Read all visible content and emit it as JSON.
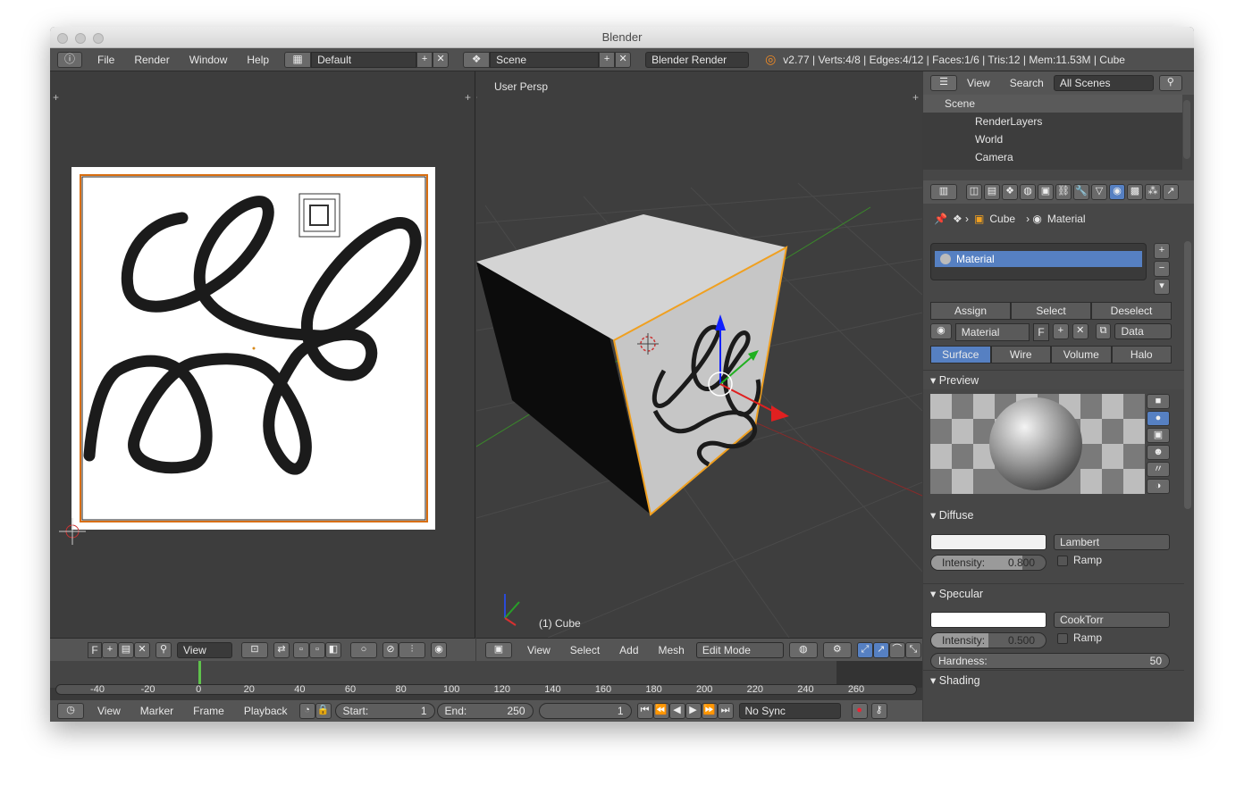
{
  "window": {
    "title": "Blender"
  },
  "topbar": {
    "menus": [
      "File",
      "Render",
      "Window",
      "Help"
    ],
    "layout_value": "Default",
    "scene_value": "Scene",
    "engine_value": "Blender Render",
    "stats": "v2.77 | Verts:4/8 | Edges:4/12 | Faces:1/6 | Tris:12 | Mem:11.53M | Cube"
  },
  "image_editor": {
    "header": {
      "f_label": "F",
      "view_label": "View"
    }
  },
  "viewport": {
    "view_label": "User Persp",
    "object_label": "(1) Cube",
    "header": {
      "view": "View",
      "select": "Select",
      "add": "Add",
      "mesh": "Mesh",
      "mode": "Edit Mode"
    }
  },
  "outliner": {
    "view": "View",
    "search": "Search",
    "filter": "All Scenes",
    "items": [
      "Scene",
      "RenderLayers",
      "World",
      "Camera"
    ]
  },
  "properties": {
    "breadcrumb": {
      "object": "Cube",
      "material": "Material"
    },
    "slot_name": "Material",
    "actions": [
      "Assign",
      "Select",
      "Deselect"
    ],
    "material_field": "Material",
    "f_label": "F",
    "data_dropdown": "Data",
    "tabs": [
      "Surface",
      "Wire",
      "Volume",
      "Halo"
    ],
    "active_tab": "Surface",
    "preview_title": "Preview",
    "diffuse": {
      "title": "Diffuse",
      "shader": "Lambert",
      "intensity_label": "Intensity:",
      "intensity_value": "0.800",
      "ramp": "Ramp",
      "intensity_fraction": 0.8
    },
    "specular": {
      "title": "Specular",
      "shader": "CookTorr",
      "intensity_label": "Intensity:",
      "intensity_value": "0.500",
      "ramp": "Ramp",
      "hardness_label": "Hardness:",
      "hardness_value": "50",
      "intensity_fraction": 0.5
    },
    "shading_title": "Shading"
  },
  "timeline": {
    "ticks": [
      "-40",
      "-20",
      "0",
      "20",
      "40",
      "60",
      "80",
      "100",
      "120",
      "140",
      "160",
      "180",
      "200",
      "220",
      "240",
      "260"
    ],
    "current_frame": 1,
    "menus": [
      "View",
      "Marker",
      "Frame",
      "Playback"
    ],
    "start_label": "Start:",
    "start_value": "1",
    "end_label": "End:",
    "end_value": "250",
    "frame_value": "1",
    "sync": "No Sync"
  },
  "colors": {
    "accent_blue": "#5680c2",
    "selection_orange": "#f0a020",
    "bg_dark": "#3d3d3d"
  }
}
